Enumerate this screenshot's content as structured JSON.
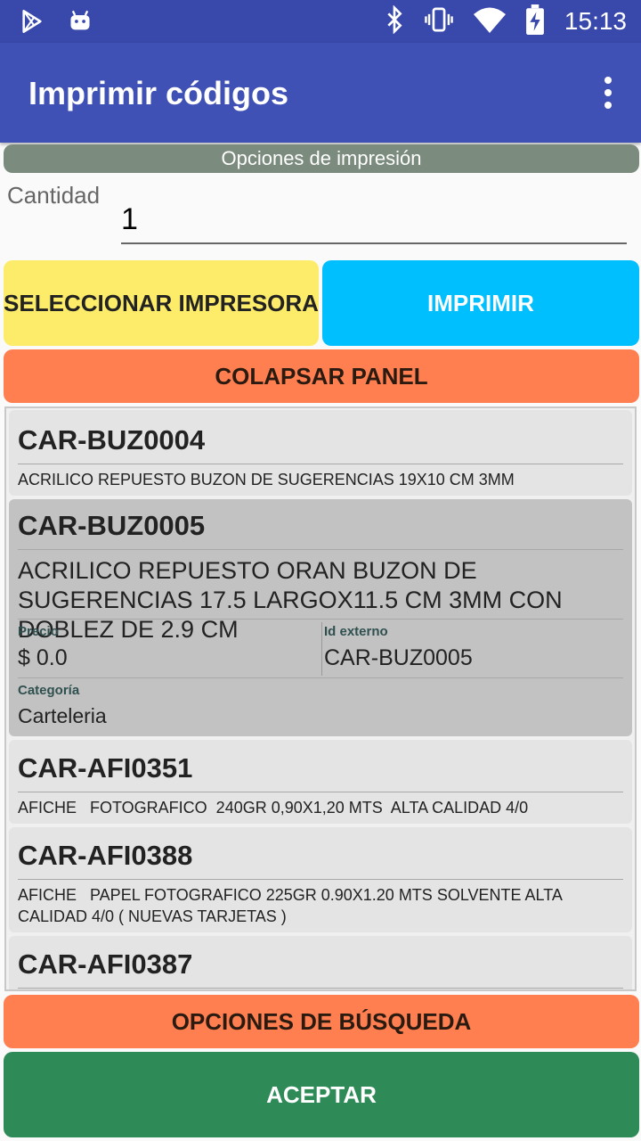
{
  "status_bar": {
    "time": "15:13",
    "icons": [
      "play-store-icon",
      "android-icon",
      "bluetooth-icon",
      "vibrate-icon",
      "wifi-icon",
      "battery-charging-icon"
    ]
  },
  "app_bar": {
    "title": "Imprimir códigos",
    "menu_icon": "more-vert-icon"
  },
  "print_options": {
    "header": "Opciones de impresión",
    "quantity_label": "Cantidad",
    "quantity_value": "1",
    "select_printer_label": "SELECCIONAR IMPRESORA",
    "print_label": "IMPRIMIR",
    "collapse_label": "COLAPSAR PANEL"
  },
  "items": [
    {
      "code": "CAR-BUZ0004",
      "description": "ACRILICO REPUESTO BUZON DE SUGERENCIAS 19X10 CM 3MM"
    },
    {
      "code": "CAR-BUZ0005",
      "description": "ACRILICO REPUESTO ORAN BUZON DE SUGERENCIAS 17.5 LARGOX11.5 CM 3MM CON DOBLEZ DE 2.9 CM",
      "price_label": "Precio",
      "price": "$ 0.0",
      "external_id_label": "Id externo",
      "external_id": "CAR-BUZ0005",
      "category_label": "Categoría",
      "category": "Carteleria"
    },
    {
      "code": "CAR-AFI0351",
      "description": "AFICHE   FOTOGRAFICO  240GR 0,90X1,20 MTS  ALTA CALIDAD 4/0"
    },
    {
      "code": "CAR-AFI0388",
      "description": "AFICHE   PAPEL FOTOGRAFICO 225GR 0.90X1.20 MTS SOLVENTE ALTA CALIDAD 4/0 ( NUEVAS TARJETAS )"
    },
    {
      "code": "CAR-AFI0387",
      "description": ""
    }
  ],
  "footer": {
    "search_options_label": "OPCIONES DE BÚSQUEDA",
    "accept_label": "ACEPTAR"
  },
  "colors": {
    "primary": "#3f51b5",
    "status_bar": "#3949ab",
    "yellow_button": "#fdec6a",
    "blue_button": "#00bfff",
    "orange_button": "#ff7f50",
    "green_button": "#2e8b57",
    "selected_card": "#c2c2c2"
  }
}
